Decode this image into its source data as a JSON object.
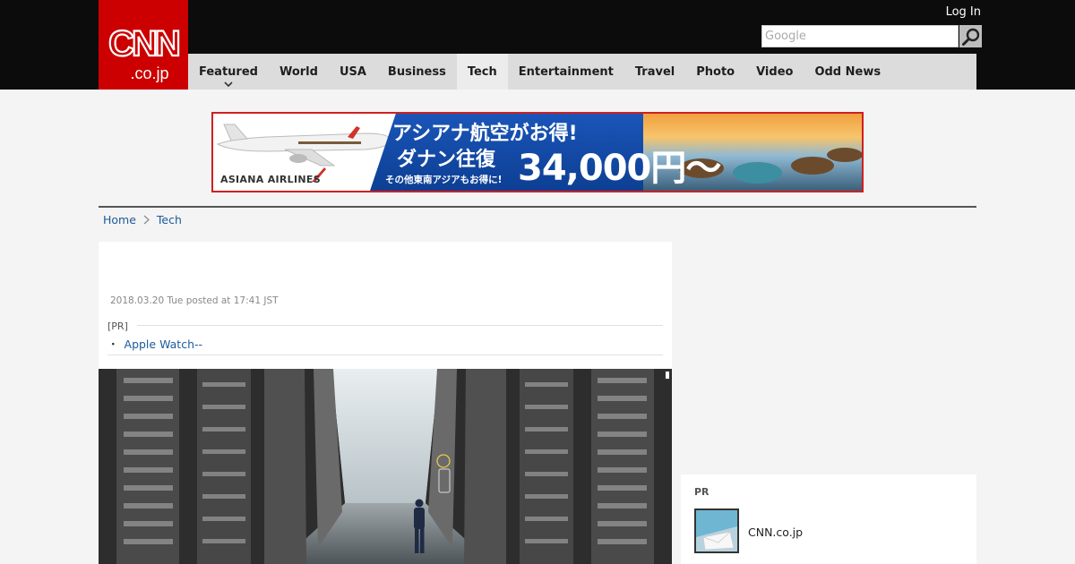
{
  "header": {
    "logo": {
      "text_top": "CNN",
      "text_bottom": ".co.jp",
      "icon": "cnn-logo",
      "color": "#cc0000"
    },
    "login_label": "Log In",
    "search": {
      "placeholder": "Google",
      "icon": "search-icon"
    }
  },
  "nav": {
    "items": [
      {
        "label": "Featured",
        "has_dropdown": true
      },
      {
        "label": "World"
      },
      {
        "label": "USA"
      },
      {
        "label": "Business"
      },
      {
        "label": "Tech",
        "active": true
      },
      {
        "label": "Entertainment"
      },
      {
        "label": "Travel"
      },
      {
        "label": "Photo"
      },
      {
        "label": "Video"
      },
      {
        "label": "Odd News"
      }
    ]
  },
  "ad": {
    "airline": "ASIANA AIRLINES",
    "line1": "アシアナ航空がお得!",
    "line2": "ダナン往復",
    "line3": "その他東南アジアもお得に!",
    "price": "34,000円〜",
    "border_color": "#d02020"
  },
  "breadcrumb": {
    "home": "Home",
    "current": "Tech"
  },
  "article": {
    "timestamp": "2018.03.20 Tue posted at 17:41 JST",
    "pr_label": "[PR]",
    "pr_bullet": "・",
    "pr_link": "Apple Watch--",
    "hero_image": "data-center-corridor-photo"
  },
  "sidebar": {
    "pr_label": "PR",
    "item_title": "CNN.co.jp",
    "item_thumb": "mail-envelope-thumbnail"
  }
}
